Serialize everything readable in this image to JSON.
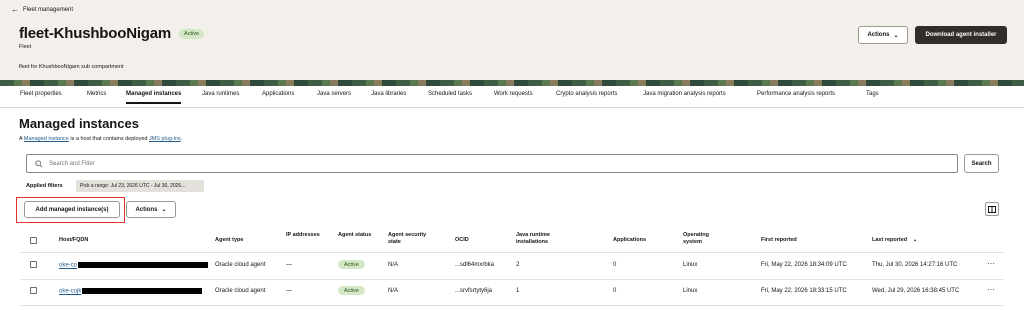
{
  "breadcrumb": {
    "label": "Fleet management"
  },
  "header": {
    "title": "fleet-KhushbooNigam",
    "status": "Active",
    "subtitle": "Fleet",
    "description": "fleet for KhushbooNigam sub compartment",
    "actions_label": "Actions",
    "download_label": "Download agent installer"
  },
  "tabs": [
    "Fleet properties",
    "Metrics",
    "Managed instances",
    "Java runtimes",
    "Applications",
    "Java servers",
    "Java libraries",
    "Scheduled tasks",
    "Work requests",
    "Crypto analysis reports",
    "Java migration analysis reports",
    "Performance analysis reports",
    "Tags"
  ],
  "active_tab": "Managed instances",
  "main": {
    "title": "Managed instances",
    "intro_prefix": "A ",
    "intro_link1": "Managed instance",
    "intro_mid": " is a host that contains deployed ",
    "intro_link2": "JMS plug-ins",
    "intro_suffix": ".",
    "search_placeholder": "Search and Filter",
    "search_button": "Search",
    "applied_filters_label": "Applied filters",
    "filter_chip": "Pick a range: Jul 23, 2026 UTC - Jul 30, 2026...",
    "add_button": "Add managed instance(s)",
    "actions_label": "Actions"
  },
  "table": {
    "headers": {
      "host": "Host/FQDN",
      "agent_type": "Agent type",
      "ip": "IP addresses",
      "agent_status": "Agent status",
      "security": "Agent security state",
      "ocid": "OCID",
      "runtimes": "Java runtime installations",
      "applications": "Applications",
      "os": "Operating system",
      "first_reported": "First reported",
      "last_reported": "Last reported"
    },
    "rows": [
      {
        "host": "oke-co",
        "agent_type": "Oracle cloud agent",
        "ip": "—",
        "status": "Active",
        "security": "N/A",
        "ocid": "...sdl64mxrbka",
        "runtimes": "2",
        "applications": "0",
        "os": "Linux",
        "first_reported": "Fri, May 22, 2026 18:34:09 UTC",
        "last_reported": "Thu, Jul 30, 2026 14:27:16 UTC"
      },
      {
        "host": "oke-cojk",
        "agent_type": "Oracle cloud agent",
        "ip": "—",
        "status": "Active",
        "security": "N/A",
        "ocid": "...srvfsrtyty6ja",
        "runtimes": "1",
        "applications": "0",
        "os": "Linux",
        "first_reported": "Fri, May 22, 2026 18:33:15 UTC",
        "last_reported": "Wed, Jul 29, 2026 16:38:45 UTC"
      }
    ]
  },
  "colors": {
    "accent_dark": "#312d2a",
    "active_badge": "#d4e7c6",
    "link": "#1f5b8c",
    "highlight_box": "#e0322b"
  }
}
